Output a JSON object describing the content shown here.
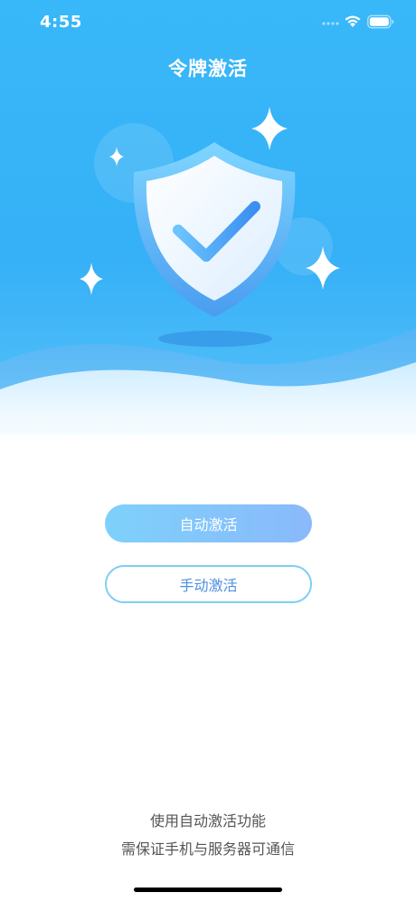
{
  "status_bar": {
    "time": "4:55"
  },
  "header": {
    "title": "令牌激活"
  },
  "actions": {
    "auto_activate_label": "自动激活",
    "manual_activate_label": "手动激活"
  },
  "footer": {
    "line1": "使用自动激活功能",
    "line2": "需保证手机与服务器可通信"
  },
  "icons": {
    "hero": "shield-check-icon",
    "sparkles": "sparkle-icon"
  },
  "colors": {
    "hero_gradient_top": "#3ab7f7",
    "hero_gradient_bottom": "#6fcbf8",
    "button_primary_start": "#7ed1fb",
    "button_primary_end": "#8ab9fb",
    "button_outline": "#7dd0ef",
    "button_outline_text": "#4f8fe0"
  }
}
